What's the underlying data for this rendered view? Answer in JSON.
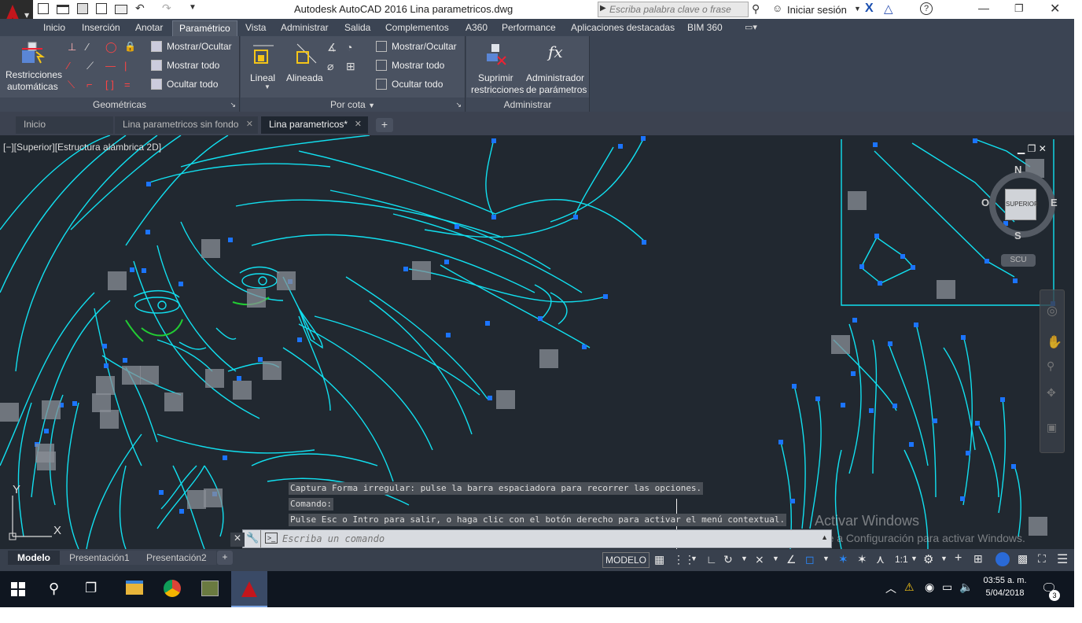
{
  "window": {
    "title": "Autodesk AutoCAD 2016   Lina parametricos.dwg",
    "search_placeholder": "Escriba palabra clave o frase",
    "signin_label": "Iniciar sesión"
  },
  "ribbon_tabs": [
    "Inicio",
    "Inserción",
    "Anotar",
    "Paramétrico",
    "Vista",
    "Administrar",
    "Salida",
    "Complementos",
    "A360",
    "Performance",
    "Aplicaciones destacadas",
    "BIM 360"
  ],
  "ribbon": {
    "geometricas": {
      "title": "Geométricas",
      "auto_label_1": "Restricciones",
      "auto_label_2": "automáticas",
      "show_hide": "Mostrar/Ocultar",
      "show_all": "Mostrar todo",
      "hide_all": "Ocultar todo"
    },
    "por_cota": {
      "title": "Por cota",
      "lineal": "Lineal",
      "alineada": "Alineada",
      "show_hide": "Mostrar/Ocultar",
      "show_all": "Mostrar todo",
      "hide_all": "Ocultar todo"
    },
    "administrar": {
      "title": "Administrar",
      "suprimir_1": "Suprimir",
      "suprimir_2": "restricciones",
      "admin_1": "Administrador",
      "admin_2": "de parámetros"
    }
  },
  "doc_tabs": [
    "Inicio",
    "Lina parametricos sin fondo",
    "Lina parametricos*"
  ],
  "viewport": {
    "label": "[−][Superior][Estructura alámbrica 2D]",
    "viewcube_top": "SUPERIOR",
    "compass_n": "N",
    "compass_s": "S",
    "compass_e": "E",
    "compass_o": "O",
    "ucs_label": "SCU",
    "axis_y": "Y",
    "axis_x": "X"
  },
  "command": {
    "history": [
      "Captura Forma irregular: pulse la barra espaciadora para recorrer las opciones.",
      "Comando:",
      "Pulse Esc o Intro para salir, o haga clic con el botón derecho para activar el menú contextual."
    ],
    "placeholder": "Escriba un comando"
  },
  "watermark": {
    "line1": "Activar Windows",
    "line2": "Ve a Configuración para activar Windows."
  },
  "layout_tabs": [
    "Modelo",
    "Presentación1",
    "Presentación2"
  ],
  "status": {
    "model": "MODELO",
    "scale": "1:1"
  },
  "taskbar": {
    "time": "03:55 a. m.",
    "date": "5/04/2018",
    "notifications": "3"
  },
  "colors": {
    "accent": "#00e5ff",
    "grip": "#1b74ff",
    "canvas": "#212830",
    "ribbon": "#3b4453"
  }
}
